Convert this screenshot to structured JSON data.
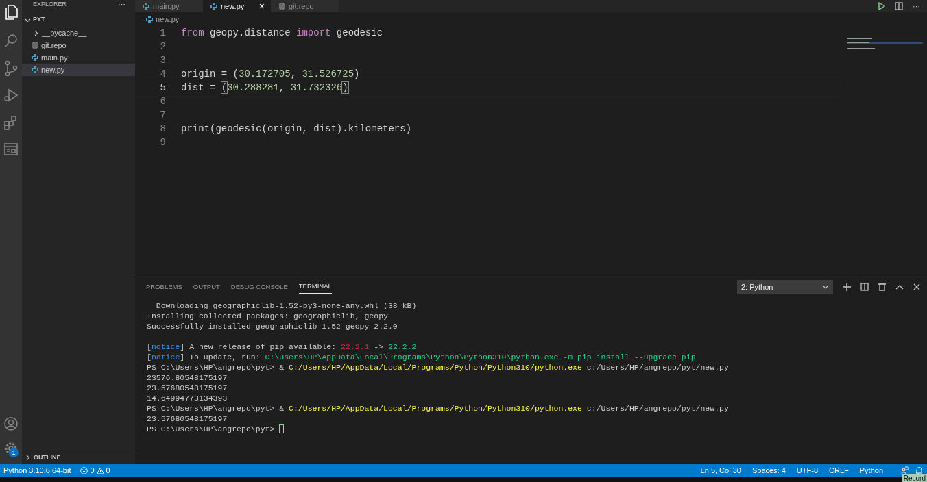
{
  "sidebar": {
    "title": "EXPLORER",
    "more": "···",
    "folder": {
      "label": "PYT",
      "expanded": true,
      "children": [
        {
          "label": "__pycache__",
          "kind": "folder",
          "expanded": false,
          "selected": false
        },
        {
          "label": "git.repo",
          "kind": "text",
          "selected": false
        },
        {
          "label": "main.py",
          "kind": "python",
          "selected": false
        },
        {
          "label": "new.py",
          "kind": "python",
          "selected": true
        }
      ]
    },
    "outline": {
      "label": "OUTLINE",
      "expanded": false
    }
  },
  "activity_bar": {
    "settings_badge": "1"
  },
  "tabs": [
    {
      "label": "main.py",
      "kind": "python",
      "selected": false
    },
    {
      "label": "new.py",
      "kind": "python",
      "selected": true,
      "close": "×"
    },
    {
      "label": "git.repo",
      "kind": "text",
      "selected": false
    }
  ],
  "breadcrumb": "new.py",
  "editor": {
    "lines": [
      {
        "number": "1",
        "tokens": [
          {
            "kind": "keyword",
            "text": "from"
          },
          {
            "kind": "plain",
            "text": " geopy.distance "
          },
          {
            "kind": "keyword",
            "text": "import"
          },
          {
            "kind": "plain",
            "text": " geodesic"
          }
        ]
      },
      {
        "number": "2"
      },
      {
        "number": "3"
      },
      {
        "number": "4",
        "tokens": [
          {
            "kind": "plain",
            "text": "origin = ("
          },
          {
            "kind": "number",
            "text": "30.172705"
          },
          {
            "kind": "plain",
            "text": ", "
          },
          {
            "kind": "number",
            "text": "31.526725"
          },
          {
            "kind": "plain",
            "text": ")"
          }
        ]
      },
      {
        "number": "5",
        "current": true,
        "tokens": [
          {
            "kind": "plain",
            "text": "dist = "
          },
          {
            "kind": "bracket",
            "text": "("
          },
          {
            "kind": "number",
            "text": "30.288281"
          },
          {
            "kind": "plain",
            "text": ", "
          },
          {
            "kind": "number",
            "text": "31.732326"
          },
          {
            "kind": "bracket",
            "text": ")"
          }
        ]
      },
      {
        "number": "6"
      },
      {
        "number": "7"
      },
      {
        "number": "8",
        "tokens": [
          {
            "kind": "plain",
            "text": "print(geodesic(origin, dist).kilometers)"
          }
        ]
      },
      {
        "number": "9"
      }
    ]
  },
  "panel": {
    "tabs": [
      {
        "label": "PROBLEMS",
        "selected": false
      },
      {
        "label": "OUTPUT",
        "selected": false
      },
      {
        "label": "DEBUG CONSOLE",
        "selected": false
      },
      {
        "label": "TERMINAL",
        "selected": true
      }
    ],
    "terminal_select": "2: Python",
    "terminal": [
      [
        {
          "kind": "plain",
          "text": "  Downloading geographiclib-1.52-py3-none-any.whl (38 kB)"
        }
      ],
      [
        {
          "kind": "plain",
          "text": "Installing collected packages: geographiclib, geopy"
        }
      ],
      [
        {
          "kind": "plain",
          "text": "Successfully installed geographiclib-1.52 geopy-2.2.0"
        }
      ],
      {
        "kind": "blank"
      },
      [
        {
          "kind": "plain",
          "text": "["
        },
        {
          "kind": "blue",
          "text": "notice"
        },
        {
          "kind": "plain",
          "text": "] A new release of pip available: "
        },
        {
          "kind": "red",
          "text": "22.2.1"
        },
        {
          "kind": "plain",
          "text": " -> "
        },
        {
          "kind": "green",
          "text": "22.2.2"
        }
      ],
      [
        {
          "kind": "plain",
          "text": "["
        },
        {
          "kind": "blue",
          "text": "notice"
        },
        {
          "kind": "plain",
          "text": "] To update, run: "
        },
        {
          "kind": "green",
          "text": "C:\\Users\\HP\\AppData\\Local\\Programs\\Python\\Python310\\python.exe -m pip install --upgrade pip"
        }
      ],
      [
        {
          "kind": "plain",
          "text": "PS C:\\Users\\HP\\angrepo\\pyt> & "
        },
        {
          "kind": "yellow",
          "text": "C:/Users/HP/AppData/Local/Programs/Python/Python310/python.exe"
        },
        {
          "kind": "plain",
          "text": " c:/Users/HP/angrepo/pyt/new.py"
        }
      ],
      [
        {
          "kind": "plain",
          "text": "23576.80548175197"
        }
      ],
      [
        {
          "kind": "plain",
          "text": "23.57680548175197"
        }
      ],
      [
        {
          "kind": "plain",
          "text": "14.64994773134393"
        }
      ],
      [
        {
          "kind": "plain",
          "text": "PS C:\\Users\\HP\\angrepo\\pyt> & "
        },
        {
          "kind": "yellow",
          "text": "C:/Users/HP/AppData/Local/Programs/Python/Python310/python.exe"
        },
        {
          "kind": "plain",
          "text": " c:/Users/HP/angrepo/pyt/new.py"
        }
      ],
      [
        {
          "kind": "plain",
          "text": "23.57680548175197"
        }
      ],
      [
        {
          "kind": "plain",
          "text": "PS C:\\Users\\HP\\angrepo\\pyt> "
        },
        {
          "kind": "cursor"
        }
      ]
    ]
  },
  "status_bar": {
    "interpreter": "Python 3.10.6 64-bit",
    "errors": "0",
    "warnings": "0",
    "right": [
      "Ln 5, Col 30",
      "Spaces: 4",
      "UTF-8",
      "CRLF",
      "Python"
    ]
  },
  "record_button": "Record"
}
